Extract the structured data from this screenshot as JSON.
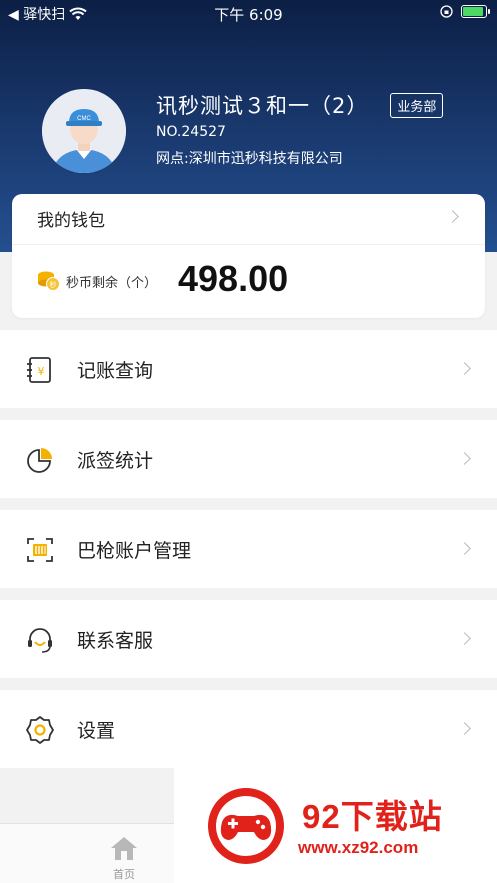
{
  "status_bar": {
    "carrier": "◀ 驿快扫",
    "time": "下午 6:09"
  },
  "profile": {
    "name": "讯秒测试３和一（2）",
    "department": "业务部",
    "number": "NO.24527",
    "site": "网点:深圳市迅秒科技有限公司",
    "avatar_cap_text": "CMC"
  },
  "wallet": {
    "title": "我的钱包",
    "balance_label": "秒币剩余（个）",
    "balance": "498.00"
  },
  "menu": [
    {
      "label": "记账查询",
      "icon": "ledger-icon"
    },
    {
      "label": "派签统计",
      "icon": "pie-chart-icon"
    },
    {
      "label": "巴枪账户管理",
      "icon": "scanner-icon"
    },
    {
      "label": "联系客服",
      "icon": "headset-icon"
    },
    {
      "label": "设置",
      "icon": "gear-icon"
    }
  ],
  "tab_bar": {
    "home_label": "首页"
  },
  "watermark": {
    "text": "92下载站",
    "url": "www.xz92.com"
  },
  "colors": {
    "accent": "#f5b100",
    "header": "#1a3a70",
    "watermark": "#e0221b"
  }
}
